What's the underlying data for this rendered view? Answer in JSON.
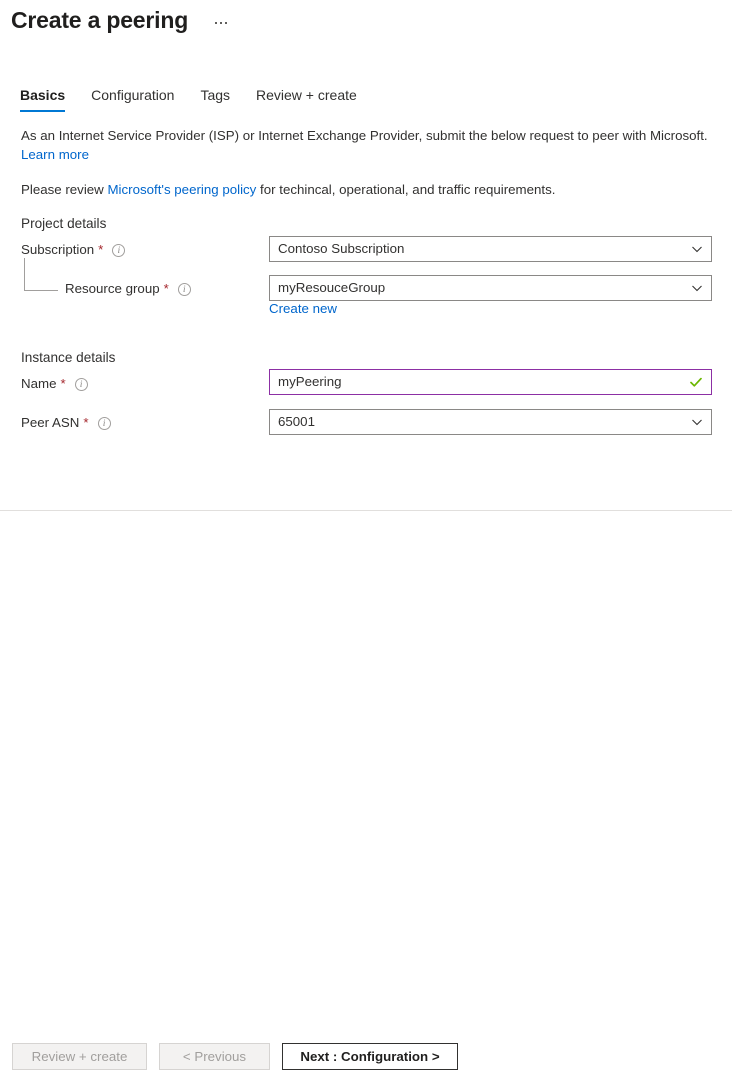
{
  "header": {
    "title": "Create a peering",
    "more_menu": "…"
  },
  "tabs": [
    {
      "label": "Basics",
      "active": true
    },
    {
      "label": "Configuration",
      "active": false
    },
    {
      "label": "Tags",
      "active": false
    },
    {
      "label": "Review + create",
      "active": false
    }
  ],
  "intro": {
    "text": "As an Internet Service Provider (ISP) or Internet Exchange Provider, submit the below request to peer with Microsoft.",
    "learn_more": "Learn more",
    "policy_prefix": "Please review ",
    "policy_link": "Microsoft's peering policy",
    "policy_suffix": " for techincal, operational, and traffic requirements."
  },
  "project_details": {
    "section_title": "Project details",
    "subscription": {
      "label": "Subscription",
      "required": "*",
      "value": "Contoso Subscription"
    },
    "resource_group": {
      "label": "Resource group",
      "required": "*",
      "value": "myResouceGroup",
      "create_new": "Create new"
    }
  },
  "instance_details": {
    "section_title": "Instance details",
    "name": {
      "label": "Name",
      "required": "*",
      "value": "myPeering"
    },
    "peer_asn": {
      "label": "Peer ASN",
      "required": "*",
      "value": "65001"
    }
  },
  "footer": {
    "review_create": "Review + create",
    "previous": "< Previous",
    "next": "Next : Configuration >"
  },
  "colors": {
    "accent": "#0078d4",
    "link": "#0066cc",
    "required": "#a4262c",
    "focus_border": "#8c2fa4",
    "valid_check": "#6bb700"
  }
}
